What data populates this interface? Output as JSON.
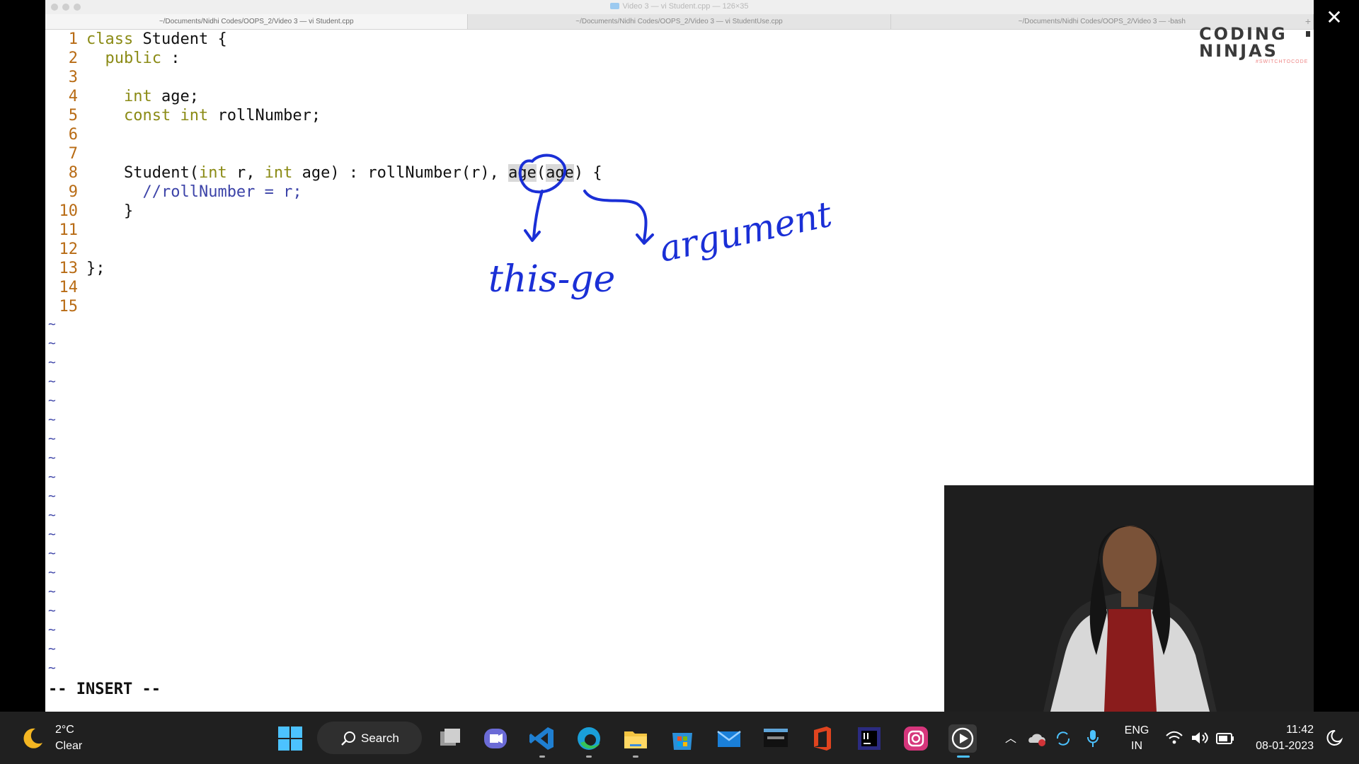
{
  "window": {
    "title": "Video 3 — vi Student.cpp — 126×35",
    "tabs": [
      "~/Documents/Nidhi Codes/OOPS_2/Video 3 — vi Student.cpp",
      "~/Documents/Nidhi Codes/OOPS_2/Video 3 — vi StudentUse.cpp",
      "~/Documents/Nidhi Codes/OOPS_2/Video 3 — -bash"
    ],
    "tab_plus": "+"
  },
  "editor": {
    "line_numbers": [
      "1",
      "2",
      "3",
      "4",
      "5",
      "6",
      "7",
      "8",
      "9",
      "10",
      "11",
      "12",
      "13",
      "14",
      "15"
    ],
    "l1a": "class",
    "l1b": " Student {",
    "l2": "public",
    "l2b": " :",
    "l4a": "int",
    "l4b": " age;",
    "l5a": "const",
    "l5b": " ",
    "l5c": "int",
    "l5d": " rollNumber;",
    "l8a": "Student(",
    "l8b": "int",
    "l8c": " r, ",
    "l8d": "int",
    "l8e": " age) : rollNumber(r), ",
    "l8f": "age",
    "l8g": "(",
    "l8h": "age",
    "l8i": ") {",
    "l9": "//rollNumber = r;",
    "l10": "}",
    "l13": "};",
    "tilde": "~",
    "mode": "-- INSERT --"
  },
  "annotation": {
    "left_text": "this-ge",
    "right_text": "argument",
    "ink_color": "#1a2fd6"
  },
  "logo": {
    "line1": "CODING",
    "line2": "NINJAS",
    "sub": "#SWITCHTOCODE"
  },
  "taskbar": {
    "weather_temp": "2°C",
    "weather_cond": "Clear",
    "search_label": "Search",
    "lang_top": "ENG",
    "lang_bottom": "IN",
    "time": "11:42",
    "date": "08-01-2023",
    "colors": {
      "bg": "#202020",
      "vscode": "#1f7fd1",
      "edge": "#1a9fd8",
      "folder": "#f4c542",
      "office": "#e0441f",
      "instagram": "#d6367c",
      "intellij": "#2b2b80"
    }
  }
}
